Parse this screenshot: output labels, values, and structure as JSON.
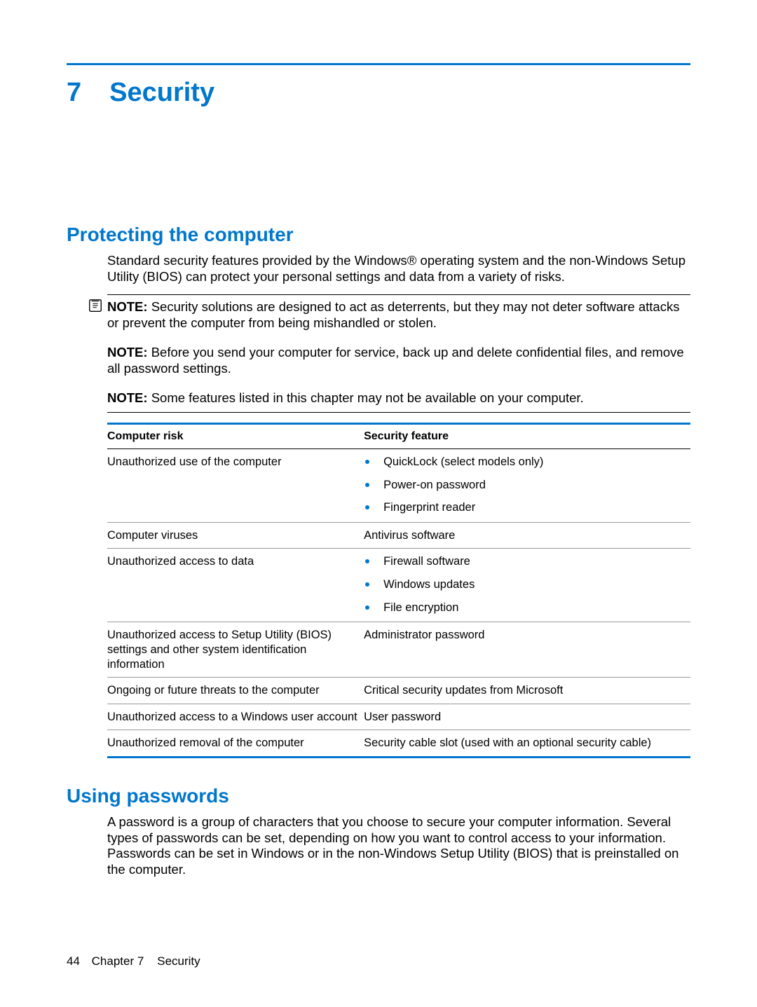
{
  "chapter": {
    "number": "7",
    "title": "Security"
  },
  "sections": {
    "protecting": {
      "heading": "Protecting the computer",
      "intro": "Standard security features provided by the Windows® operating system and the non-Windows Setup Utility (BIOS) can protect your personal settings and data from a variety of risks.",
      "notes": [
        {
          "label": "NOTE:",
          "text": "Security solutions are designed to act as deterrents, but they may not deter software attacks or prevent the computer from being mishandled or stolen."
        },
        {
          "label": "NOTE:",
          "text": "Before you send your computer for service, back up and delete confidential files, and remove all password settings."
        },
        {
          "label": "NOTE:",
          "text": "Some features listed in this chapter may not be available on your computer."
        }
      ],
      "table": {
        "headers": {
          "risk": "Computer risk",
          "feature": "Security feature"
        },
        "rows": [
          {
            "risk": "Unauthorized use of the computer",
            "features": [
              "QuickLock (select models only)",
              "Power-on password",
              "Fingerprint reader"
            ],
            "bulleted": true
          },
          {
            "risk": "Computer viruses",
            "features": [
              "Antivirus software"
            ],
            "bulleted": false
          },
          {
            "risk": "Unauthorized access to data",
            "features": [
              "Firewall software",
              "Windows updates",
              "File encryption"
            ],
            "bulleted": true
          },
          {
            "risk": "Unauthorized access to Setup Utility (BIOS) settings and other system identification information",
            "features": [
              "Administrator password"
            ],
            "bulleted": false
          },
          {
            "risk": "Ongoing or future threats to the computer",
            "features": [
              "Critical security updates from Microsoft"
            ],
            "bulleted": false
          },
          {
            "risk": "Unauthorized access to a Windows user account",
            "features": [
              "User password"
            ],
            "bulleted": false
          },
          {
            "risk": "Unauthorized removal of the computer",
            "features": [
              "Security cable slot (used with an optional security cable)"
            ],
            "bulleted": false
          }
        ]
      }
    },
    "passwords": {
      "heading": "Using passwords",
      "intro": "A password is a group of characters that you choose to secure your computer information. Several types of passwords can be set, depending on how you want to control access to your information. Passwords can be set in Windows or in the non-Windows Setup Utility (BIOS) that is preinstalled on the computer."
    }
  },
  "footer": {
    "page": "44",
    "chapter_label": "Chapter 7",
    "chapter_title": "Security"
  }
}
